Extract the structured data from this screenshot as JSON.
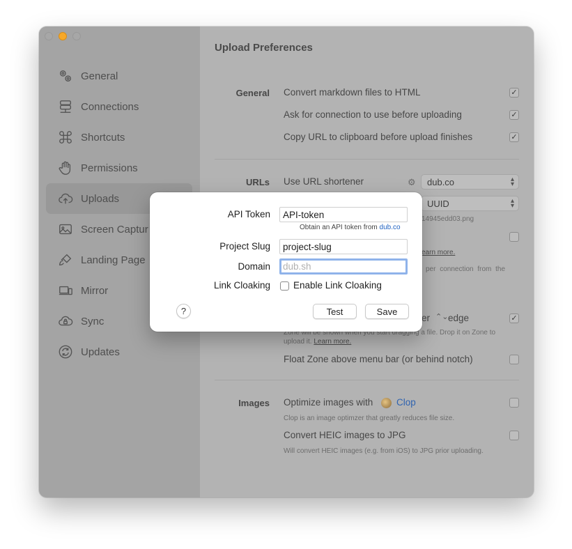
{
  "sidebar": {
    "items": [
      {
        "label": "General",
        "icon": "gears-icon"
      },
      {
        "label": "Connections",
        "icon": "network-icon"
      },
      {
        "label": "Shortcuts",
        "icon": "command-icon"
      },
      {
        "label": "Permissions",
        "icon": "hand-icon"
      },
      {
        "label": "Uploads",
        "icon": "cloud-upload-icon",
        "active": true
      },
      {
        "label": "Screen Captur",
        "icon": "photo-icon"
      },
      {
        "label": "Landing Page",
        "icon": "paintbrush-icon"
      },
      {
        "label": "Mirror",
        "icon": "devices-icon"
      },
      {
        "label": "Sync",
        "icon": "cloud-lock-icon"
      },
      {
        "label": "Updates",
        "icon": "refresh-icon"
      }
    ]
  },
  "content": {
    "title": "Upload Preferences",
    "general": {
      "label": "General",
      "opt1": "Convert markdown files to HTML",
      "opt2": "Ask for connection to use before uploading",
      "opt3": "Copy URL to clipboard before upload finishes"
    },
    "urls": {
      "label": "URLs",
      "shortener_label": "Use URL shortener",
      "shortener_value": "dub.co",
      "naming_value": "UUID",
      "filename_partial": "14945edd03.png",
      "learn_partial": "earn more.",
      "per_conn_text": "per   connection   from   the"
    },
    "zone": {
      "edge_fragment": "er",
      "edge_value": "edge",
      "desc_line1": "Zone will be shown when you start dragging a file. Drop it on Zone to",
      "desc_line2": "upload it.",
      "learn_more": "Learn more.",
      "float_label": "Float Zone above menu bar (or behind notch)"
    },
    "images": {
      "label": "Images",
      "optimize_label": "Optimize images with",
      "clop": "Clop",
      "optimize_desc": "Clop is an image optimzer that greatly reduces file size.",
      "heic_label": "Convert HEIC images to JPG",
      "heic_desc": "Will convert HEIC images (e.g. from iOS) to JPG prior uploading."
    },
    "colors": {
      "link": "#2163c2",
      "focus": "#8fb3ea",
      "traffic_min": "#f7a829"
    }
  },
  "dialog": {
    "api_token_label": "API Token",
    "api_token_value": "API-token",
    "hint_prefix": "Obtain an API token from",
    "hint_link": "dub.co",
    "project_slug_label": "Project Slug",
    "project_slug_value": "project-slug",
    "domain_label": "Domain",
    "domain_placeholder": "dub.sh",
    "link_cloaking_label": "Link Cloaking",
    "link_cloaking_checkbox": "Enable Link Cloaking",
    "help": "?",
    "test": "Test",
    "save": "Save"
  }
}
